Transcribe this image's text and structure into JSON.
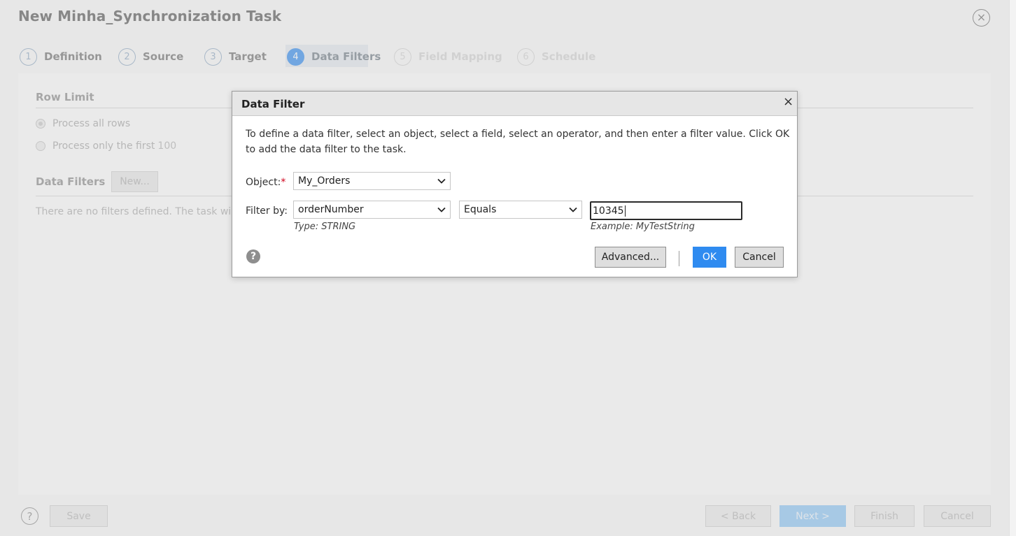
{
  "window": {
    "title": "New Minha_Synchronization Task",
    "close_glyph": "×"
  },
  "steps": [
    {
      "num": "1",
      "label": "Definition"
    },
    {
      "num": "2",
      "label": "Source"
    },
    {
      "num": "3",
      "label": "Target"
    },
    {
      "num": "4",
      "label": "Data Filters"
    },
    {
      "num": "5",
      "label": "Field Mapping"
    },
    {
      "num": "6",
      "label": "Schedule"
    }
  ],
  "row_limit": {
    "heading": "Row Limit",
    "option_all": "Process all rows",
    "option_first": "Process only the first",
    "first_value": "100"
  },
  "data_filters": {
    "heading": "Data Filters",
    "new_button": "New...",
    "empty_text": "There are no filters defined. The task will proc"
  },
  "footer": {
    "help_glyph": "?",
    "save": "Save",
    "back": "< Back",
    "next": "Next >",
    "finish": "Finish",
    "cancel": "Cancel"
  },
  "dialog": {
    "title": "Data Filter",
    "close_glyph": "×",
    "instructions": "To define a data filter, select an object, select a field, select an operator, and then enter a filter value. Click OK to add the data filter to the task.",
    "object_label": "Object:",
    "required_mark": "*",
    "object_value": "My_Orders",
    "filter_label": "Filter by:",
    "field_value": "orderNumber",
    "operator_value": "Equals",
    "filter_value": "10345",
    "type_hint": "Type: STRING",
    "example_hint": "Example: MyTestString",
    "help_glyph": "?",
    "advanced_button": "Advanced...",
    "ok_button": "OK",
    "cancel_button": "Cancel"
  },
  "colors": {
    "accent": "#2f8bf0",
    "required": "#d0021b"
  }
}
